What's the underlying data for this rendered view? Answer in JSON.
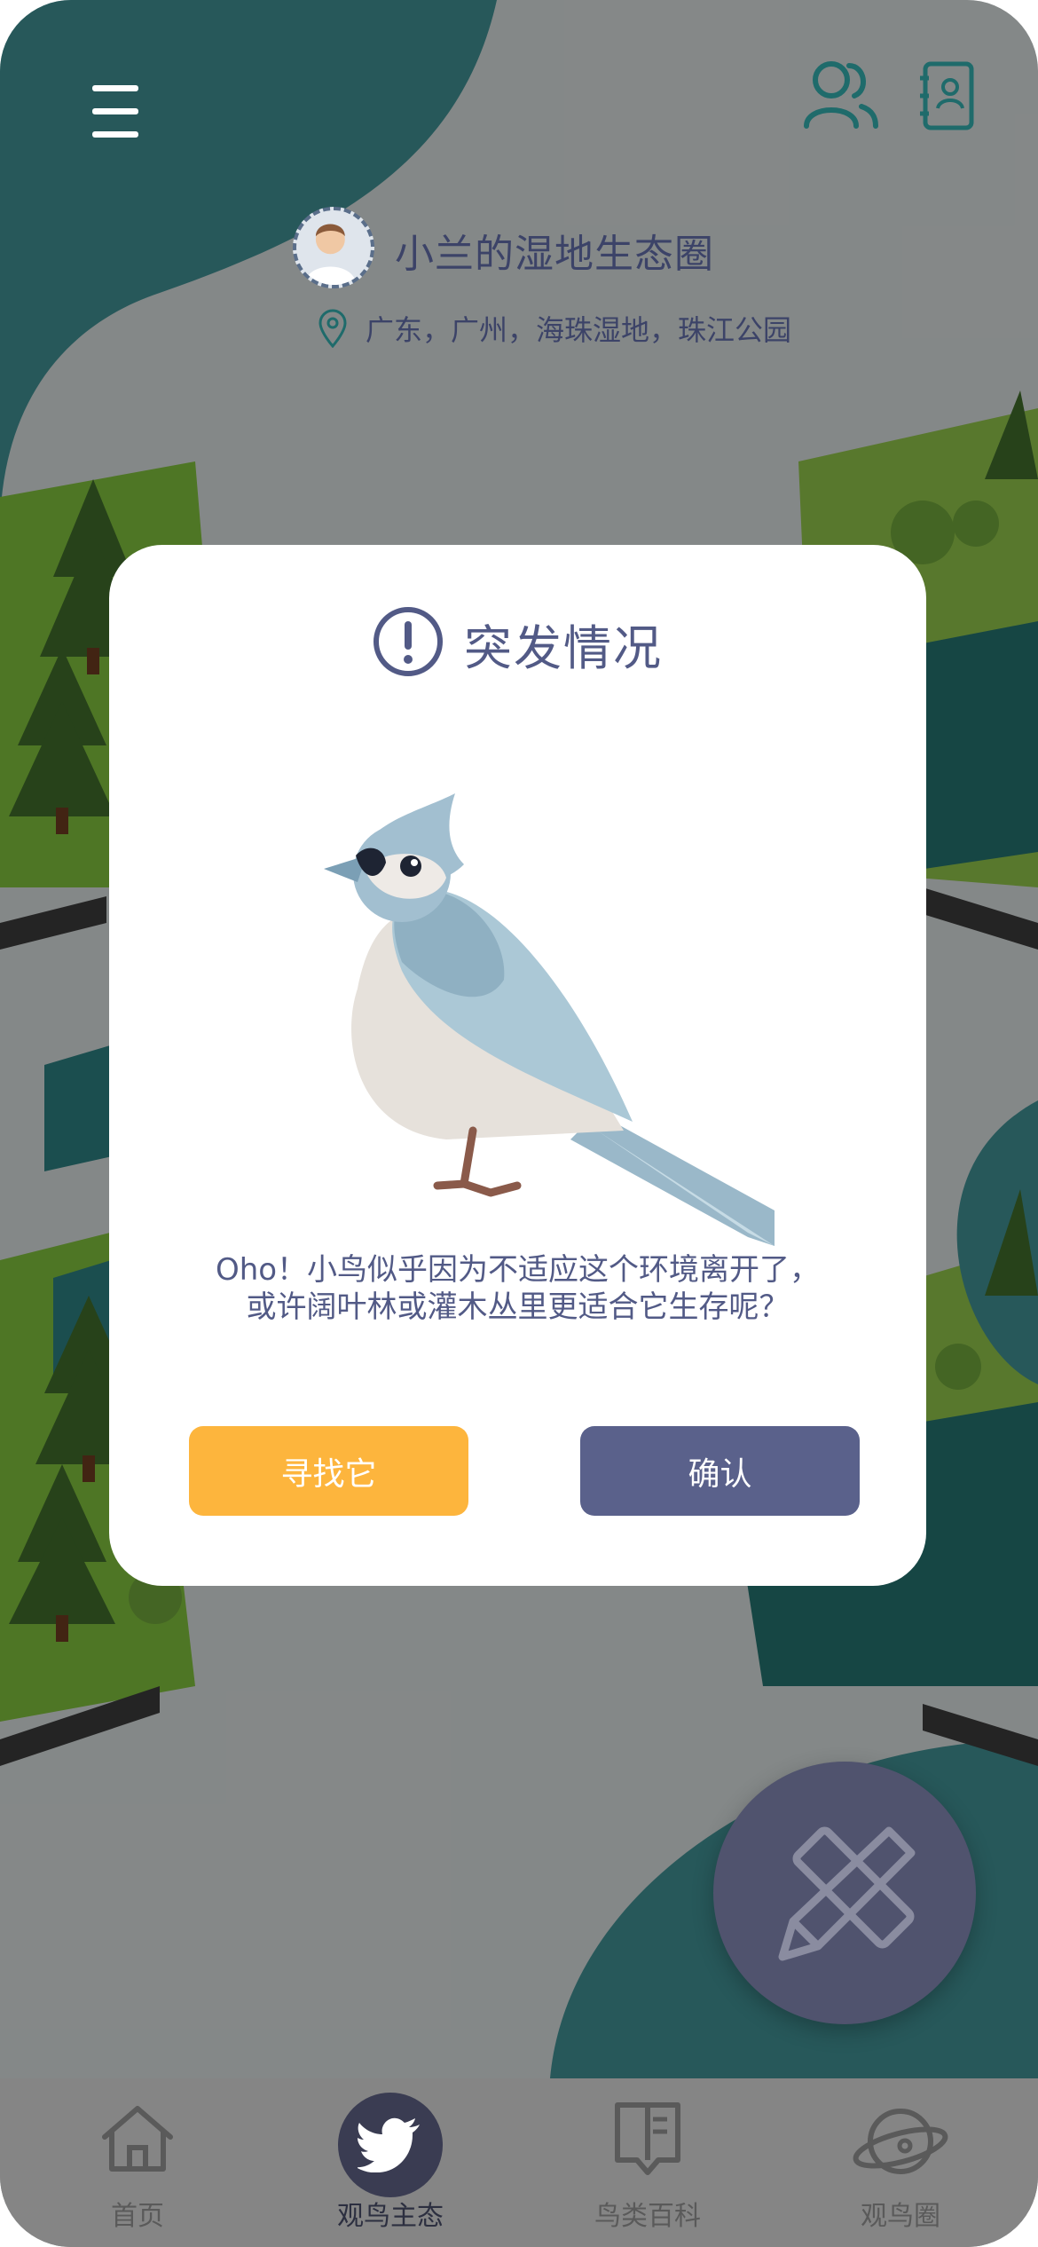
{
  "header": {
    "title": "小兰的湿地生态圈",
    "location": "广东，广州，海珠湿地，珠江公园"
  },
  "icons": {
    "menu": "menu-icon",
    "friends": "friends-icon",
    "contacts": "contacts-book-icon",
    "location": "location-pin-icon",
    "alert": "exclamation-circle-icon",
    "fab": "pencil-ruler-icon"
  },
  "dialog": {
    "title": "突发情况",
    "message_line1": "Oho！小鸟似乎因为不适应这个环境离开了，",
    "message_line2": "或许阔叶林或灌木丛里更适合它生存呢？",
    "find_button": "寻找它",
    "confirm_button": "确认"
  },
  "tabs": [
    {
      "label": "首页",
      "icon": "home-icon",
      "active": false
    },
    {
      "label": "观鸟主态",
      "icon": "bird-icon",
      "active": true
    },
    {
      "label": "鸟类百科",
      "icon": "book-icon",
      "active": false
    },
    {
      "label": "观鸟圈",
      "icon": "planet-icon",
      "active": false
    }
  ],
  "colors": {
    "accent_orange": "#fdb53d",
    "accent_purple": "#5a618b",
    "title_text": "#525a86",
    "teal": "#1f6b6b"
  }
}
